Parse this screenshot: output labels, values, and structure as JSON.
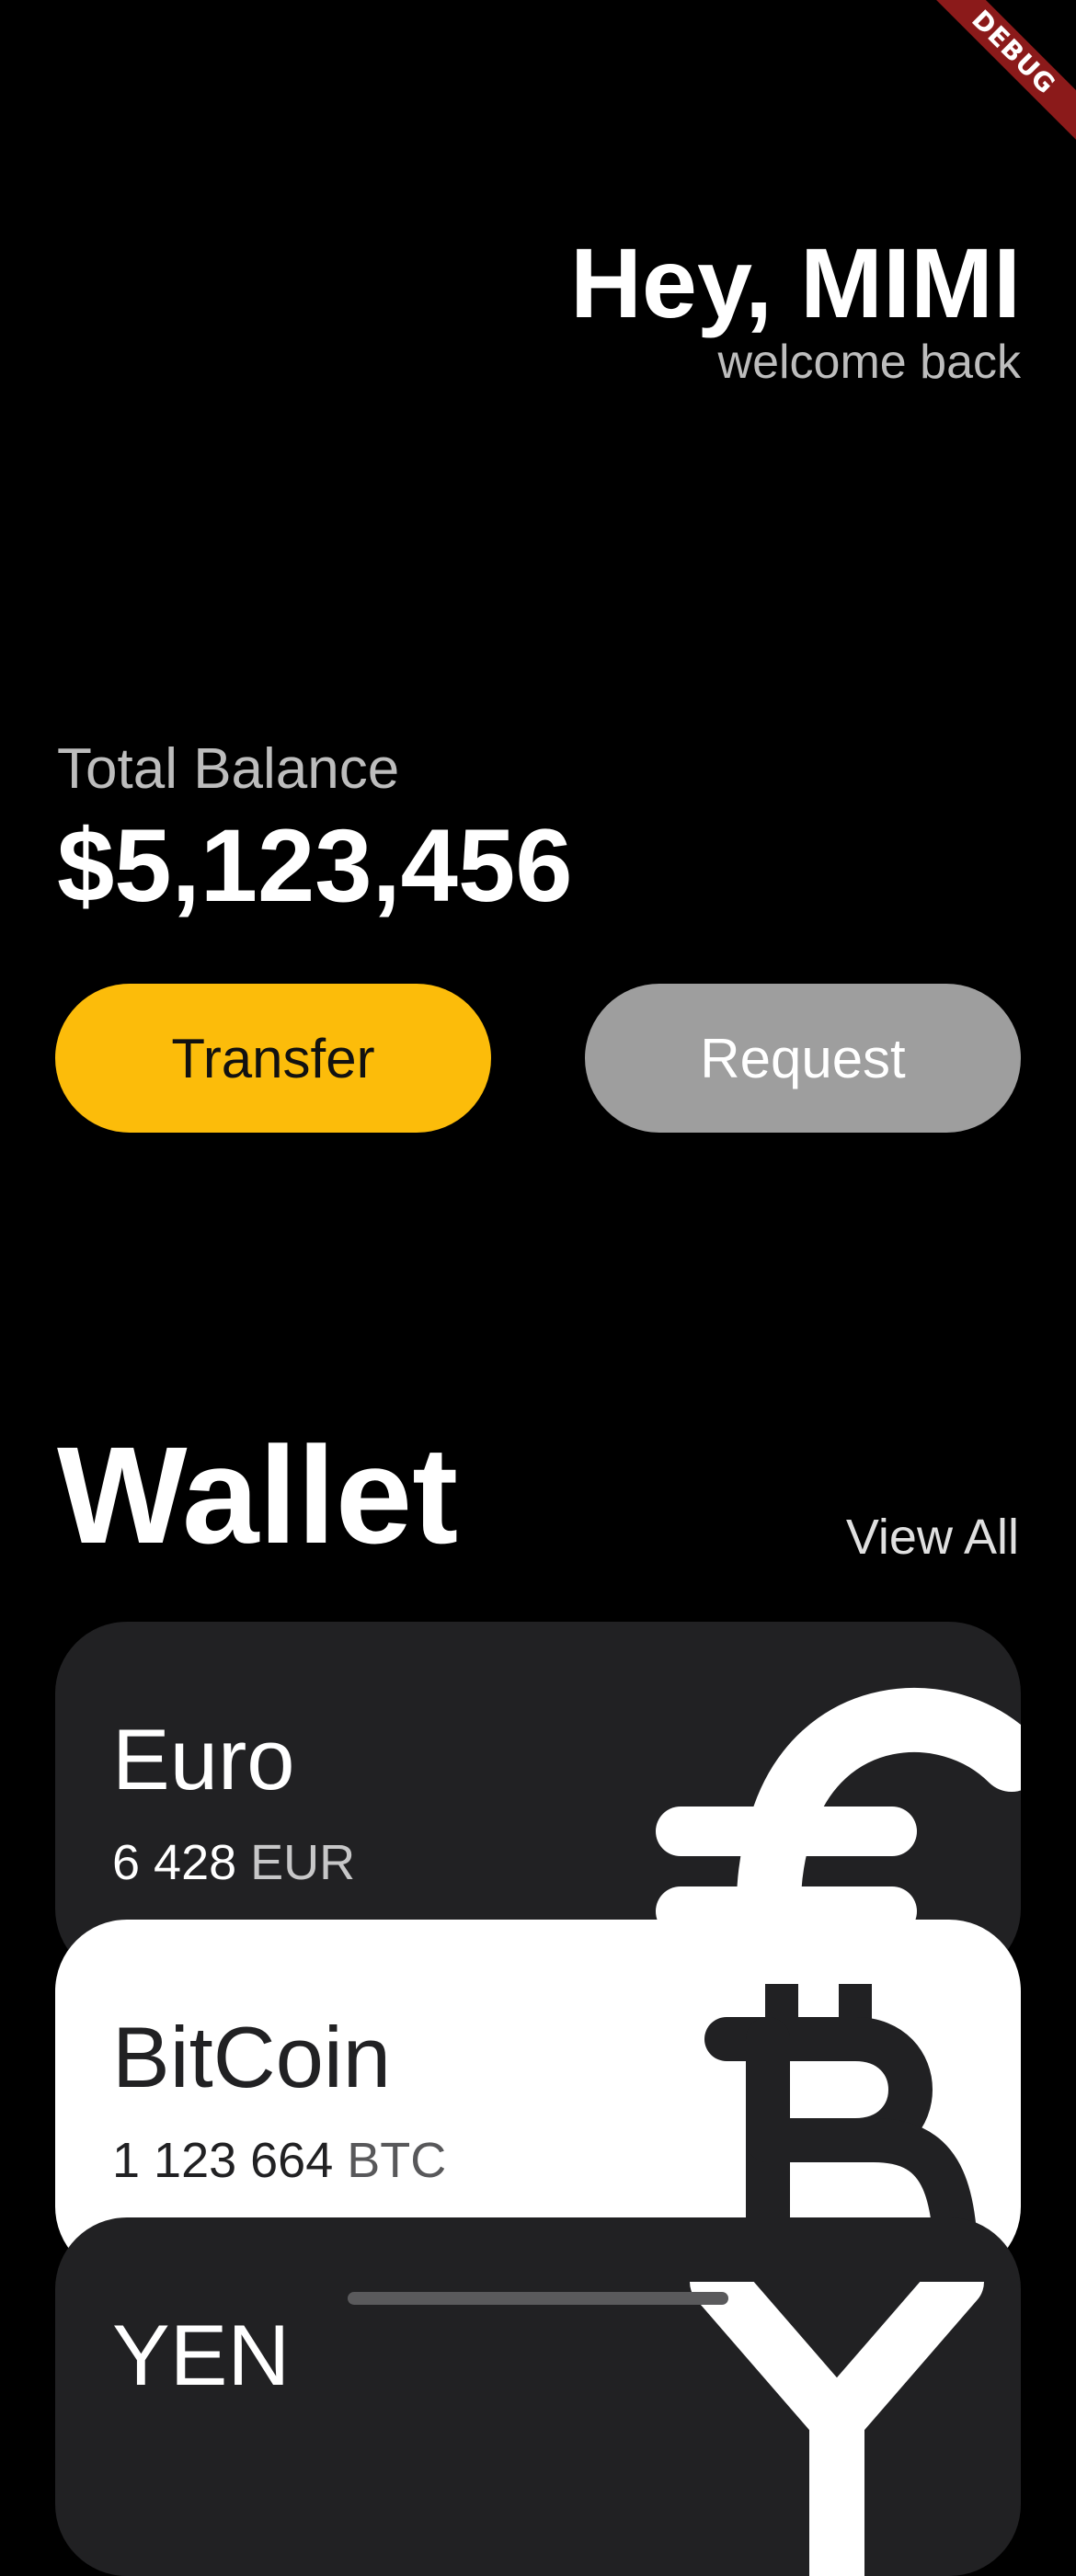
{
  "debug_banner": "DEBUG",
  "greeting": {
    "title": "Hey, MIMI",
    "subtitle": "welcome back"
  },
  "balance": {
    "label": "Total Balance",
    "value": "$5,123,456"
  },
  "actions": {
    "transfer_label": "Transfer",
    "request_label": "Request"
  },
  "wallet": {
    "title": "Wallet",
    "view_all_label": "View All",
    "cards": [
      {
        "name": "Euro",
        "amount": "6 428",
        "code": "EUR",
        "icon": "euro-icon",
        "theme": "dark"
      },
      {
        "name": "BitCoin",
        "amount": "1 123 664",
        "code": "BTC",
        "icon": "bitcoin-icon",
        "theme": "light"
      },
      {
        "name": "YEN",
        "amount": "",
        "code": "",
        "icon": "yen-icon",
        "theme": "dark"
      }
    ]
  },
  "colors": {
    "background": "#000000",
    "accent": "#fcbc0a",
    "request_button": "#9e9e9e",
    "card_dark": "#212123",
    "card_light": "#ffffff",
    "debug_ribbon": "#8b1a1a"
  }
}
